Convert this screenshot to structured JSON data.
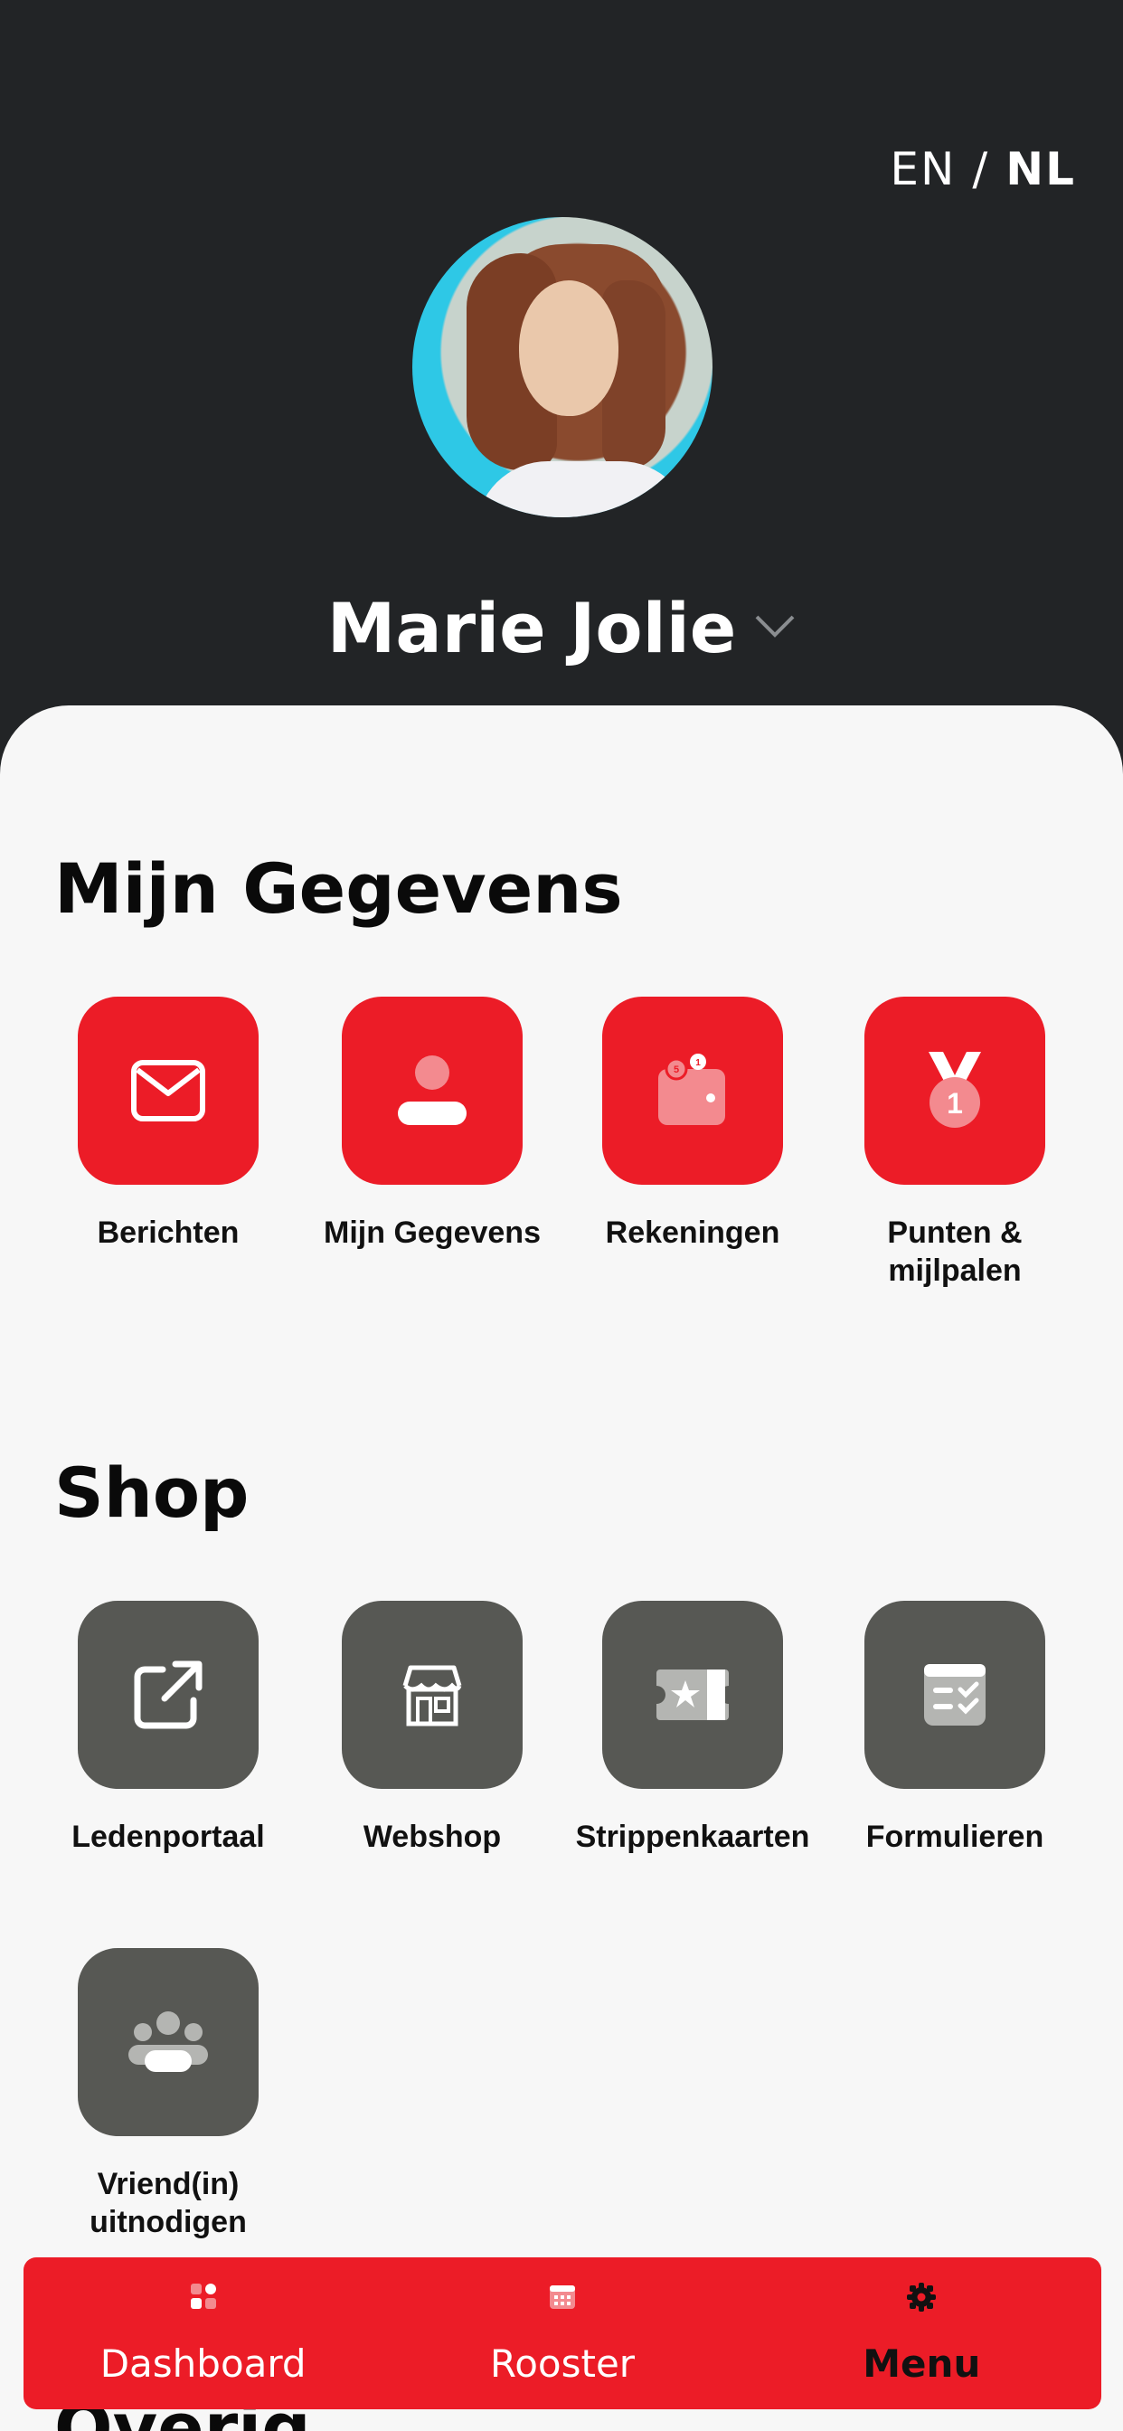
{
  "language": {
    "options": [
      "EN",
      "NL"
    ],
    "separator": "/",
    "active": "NL"
  },
  "profile": {
    "name": "Marie Jolie"
  },
  "sections": [
    {
      "title": "Mijn Gegevens",
      "items": [
        {
          "label": "Berichten",
          "icon": "envelope-icon"
        },
        {
          "label": "Mijn Gegevens",
          "icon": "user-icon"
        },
        {
          "label": "Rekeningen",
          "icon": "wallet-icon"
        },
        {
          "label": "Punten & mijlpalen",
          "icon": "medal-icon"
        }
      ]
    },
    {
      "title": "Shop",
      "items": [
        {
          "label": "Ledenportaal",
          "icon": "external-link-icon"
        },
        {
          "label": "Webshop",
          "icon": "store-icon"
        },
        {
          "label": "Strippenkaarten",
          "icon": "ticket-icon"
        },
        {
          "label": "Formulieren",
          "icon": "form-icon"
        },
        {
          "label": "Vriend(in) uitnodigen",
          "icon": "group-icon"
        }
      ]
    }
  ],
  "next_section_peek": "Overig",
  "bottom_nav": [
    {
      "label": "Dashboard",
      "icon": "dashboard-icon"
    },
    {
      "label": "Rooster",
      "icon": "calendar-icon"
    },
    {
      "label": "Menu",
      "icon": "gear-icon",
      "active": true
    }
  ],
  "colors": {
    "header": "#222426",
    "accent": "#ec1c27",
    "tile_grey": "#575854",
    "sheet": "#f7f7f7"
  }
}
